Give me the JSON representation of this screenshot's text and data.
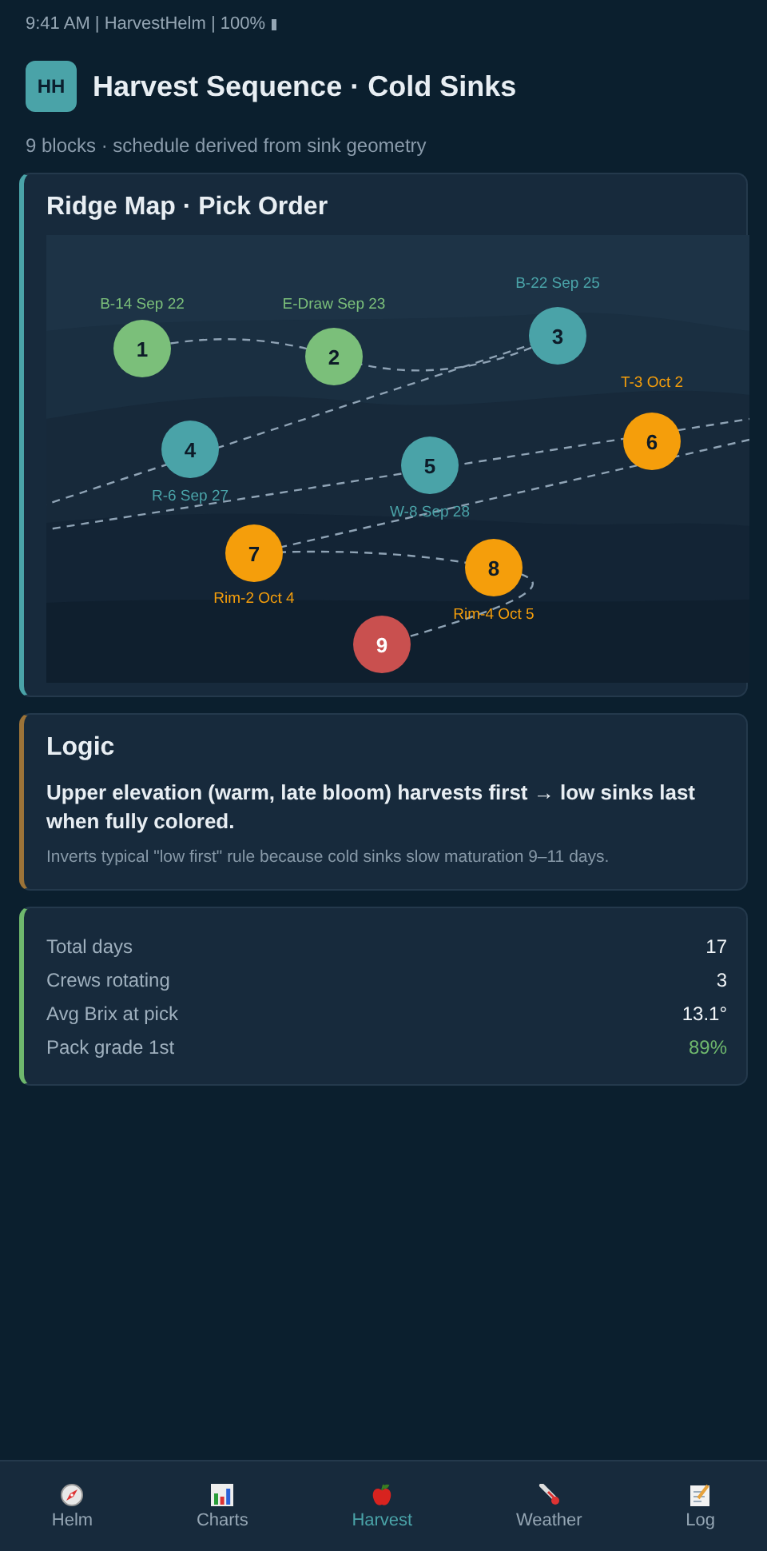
{
  "status_bar": {
    "text": "9:41 AM | HarvestHelm | 100%"
  },
  "header": {
    "logo": "HH",
    "title": "Harvest Sequence · Cold Sinks",
    "subtitle": "9 blocks · schedule derived from sink geometry"
  },
  "map": {
    "title": "Ridge Map · Pick Order",
    "blocks": [
      {
        "number": "1",
        "label": "B-14 Sep 22",
        "color": "#7bbf7a"
      },
      {
        "number": "2",
        "label": "E-Draw Sep 23",
        "color": "#7bbf7a"
      },
      {
        "number": "3",
        "label": "B-22 Sep 25",
        "color": "#4aa3a8"
      },
      {
        "number": "4",
        "label": "R-6 Sep 27",
        "color": "#4aa3a8"
      },
      {
        "number": "5",
        "label": "W-8 Sep 28",
        "color": "#4aa3a8"
      },
      {
        "number": "6",
        "label": "T-3 Oct 2",
        "color": "#f59e0b"
      },
      {
        "number": "7",
        "label": "Rim-2 Oct 4",
        "color": "#f59e0b"
      },
      {
        "number": "8",
        "label": "Rim-4 Oct 5",
        "color": "#f59e0b"
      },
      {
        "number": "9",
        "color": "#c9504f"
      }
    ]
  },
  "logic": {
    "title": "Logic",
    "statement": "Upper elevation (warm, late bloom) harvests first → low sinks last when fully colored.",
    "note": "Inverts typical \"low first\" rule because cold sinks slow maturation 9–11 days."
  },
  "stats": [
    {
      "label": "Total days",
      "value": "17",
      "kind": "plain"
    },
    {
      "label": "Crews rotating",
      "value": "3",
      "kind": "plain"
    },
    {
      "label": "Avg Brix at pick",
      "value": "13.1°",
      "kind": "plain"
    },
    {
      "label": "Pack grade 1st",
      "value": "89%",
      "kind": "good"
    }
  ],
  "nav": [
    {
      "label": "Helm",
      "selected": false
    },
    {
      "label": "Charts",
      "selected": false
    },
    {
      "label": "Harvest",
      "selected": true
    },
    {
      "label": "Weather",
      "selected": false
    },
    {
      "label": "Log",
      "selected": false
    }
  ]
}
